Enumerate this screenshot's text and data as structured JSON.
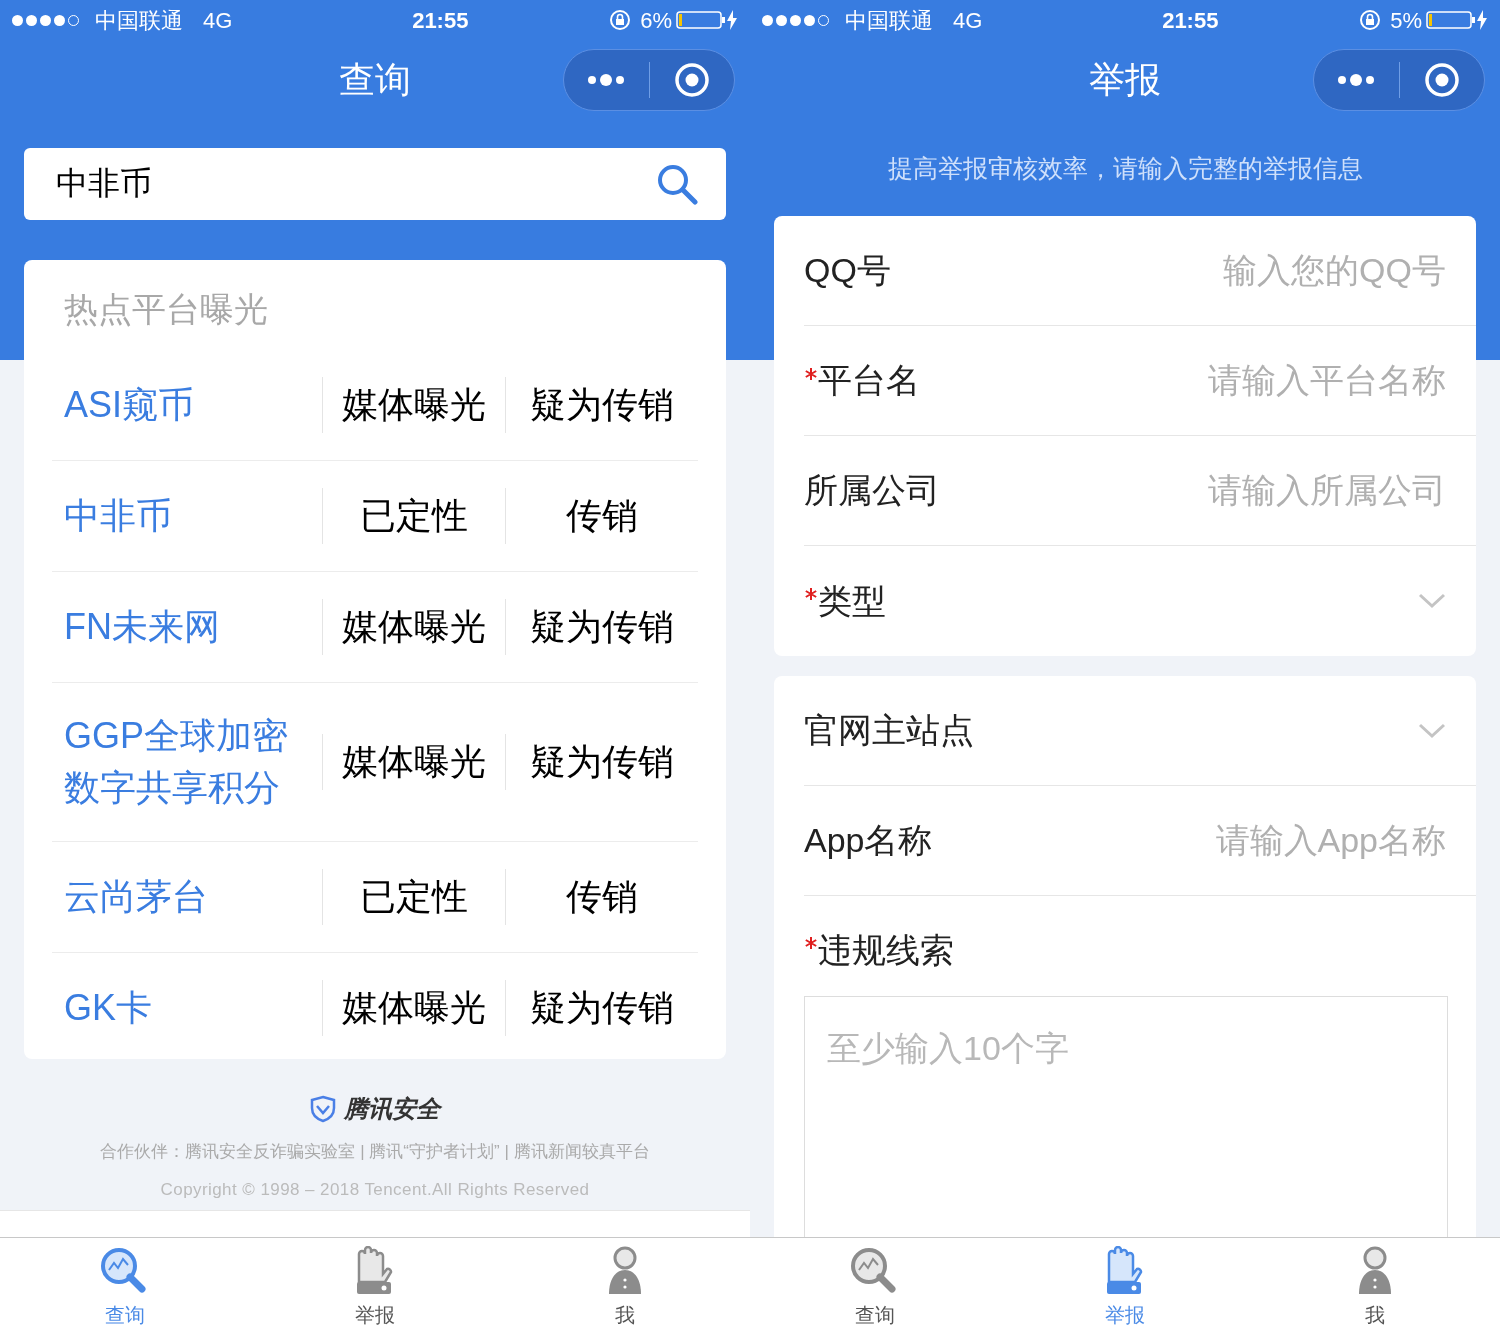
{
  "screens": [
    {
      "status_bar": {
        "carrier": "中国联通",
        "network": "4G",
        "time": "21:55",
        "battery": "6%"
      },
      "title": "查询",
      "search": {
        "value": "中非币"
      },
      "hot_list": {
        "title": "热点平台曝光",
        "rows": [
          {
            "name": "ASI窥币",
            "source": "媒体曝光",
            "category": "疑为传销"
          },
          {
            "name": "中非币",
            "source": "已定性",
            "category": "传销"
          },
          {
            "name": "FN未来网",
            "source": "媒体曝光",
            "category": "疑为传销"
          },
          {
            "name": "GGP全球加密数字共享积分",
            "source": "媒体曝光",
            "category": "疑为传销"
          },
          {
            "name": "云尚茅台",
            "source": "已定性",
            "category": "传销"
          },
          {
            "name": "GK卡",
            "source": "媒体曝光",
            "category": "疑为传销"
          }
        ]
      },
      "footer": {
        "brand": "腾讯安全",
        "partners": "合作伙伴：腾讯安全反诈骗实验室 | 腾讯“守护者计划” | 腾讯新闻较真平台",
        "copyright": "Copyright © 1998 – 2018 Tencent.All Rights Reserved"
      },
      "tab_bar": [
        {
          "label": "查询",
          "selected": true
        },
        {
          "label": "举报",
          "selected": false
        },
        {
          "label": "我",
          "selected": false
        }
      ]
    },
    {
      "status_bar": {
        "carrier": "中国联通",
        "network": "4G",
        "time": "21:55",
        "battery": "5%"
      },
      "title": "举报",
      "subtitle": "提高举报审核效率，请输入完整的举报信息",
      "form_sections": [
        {
          "fields": [
            {
              "kind": "input",
              "label": "QQ号",
              "required": false,
              "placeholder": "输入您的QQ号"
            },
            {
              "kind": "input",
              "label": "平台名",
              "required": true,
              "placeholder": "请输入平台名称"
            },
            {
              "kind": "input",
              "label": "所属公司",
              "required": false,
              "placeholder": "请输入所属公司"
            },
            {
              "kind": "select",
              "label": "类型",
              "required": true
            }
          ]
        },
        {
          "fields": [
            {
              "kind": "select",
              "label": "官网主站点",
              "required": false
            },
            {
              "kind": "input",
              "label": "App名称",
              "required": false,
              "placeholder": "请输入App名称"
            },
            {
              "kind": "textarea",
              "label": "违规线索",
              "required": true,
              "placeholder": "至少输入10个字"
            }
          ]
        }
      ],
      "tab_bar": [
        {
          "label": "查询",
          "selected": false
        },
        {
          "label": "举报",
          "selected": true
        },
        {
          "label": "我",
          "selected": false
        }
      ]
    }
  ]
}
